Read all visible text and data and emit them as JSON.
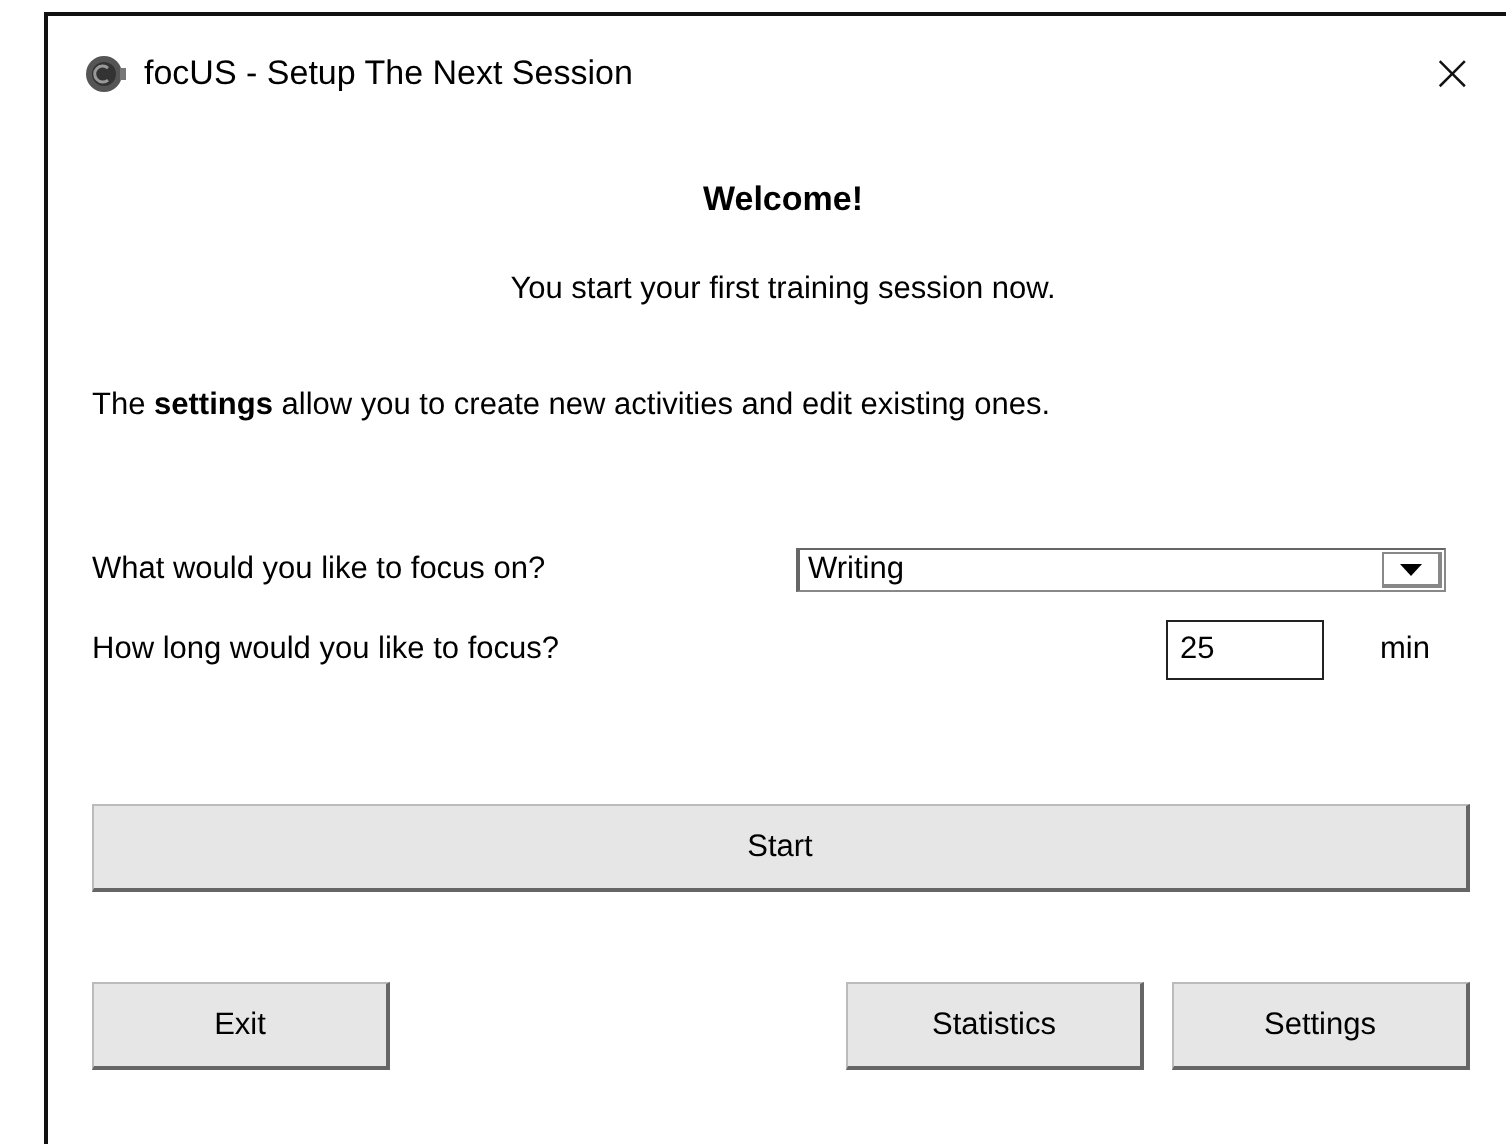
{
  "window": {
    "title": "focUS - Setup The Next Session",
    "close": "×"
  },
  "heading": "Welcome!",
  "intro": "You start your first training session now.",
  "settings_note": "The **settings** allow you to create new activities and edit existing ones.",
  "activity": {
    "label": "What would you like to focus on?",
    "value": "Writing"
  },
  "duration": {
    "label": "How long would you like to focus?",
    "value": "25",
    "unit": "min"
  },
  "start_button": "Start",
  "buttons": [
    {
      "label": "Exit",
      "kind": "left"
    },
    {
      "label": "Statistics",
      "kind": "right"
    },
    {
      "label": "Settings",
      "kind": "right"
    }
  ]
}
